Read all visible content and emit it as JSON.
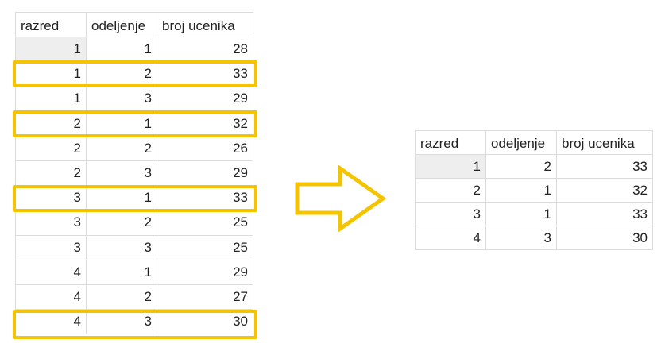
{
  "source_table": {
    "headers": [
      "razred",
      "odeljenje",
      "broj ucenika"
    ],
    "rows": [
      [
        "1",
        "1",
        "28"
      ],
      [
        "1",
        "2",
        "33"
      ],
      [
        "1",
        "3",
        "29"
      ],
      [
        "2",
        "1",
        "32"
      ],
      [
        "2",
        "2",
        "26"
      ],
      [
        "2",
        "3",
        "29"
      ],
      [
        "3",
        "1",
        "33"
      ],
      [
        "3",
        "2",
        "25"
      ],
      [
        "3",
        "3",
        "25"
      ],
      [
        "4",
        "1",
        "29"
      ],
      [
        "4",
        "2",
        "27"
      ],
      [
        "4",
        "3",
        "30"
      ]
    ],
    "highlighted_rows": [
      1,
      3,
      6,
      11
    ]
  },
  "result_table": {
    "headers": [
      "razred",
      "odeljenje",
      "broj ucenika"
    ],
    "rows": [
      [
        "1",
        "2",
        "33"
      ],
      [
        "2",
        "1",
        "32"
      ],
      [
        "3",
        "1",
        "33"
      ],
      [
        "4",
        "3",
        "30"
      ]
    ]
  },
  "colors": {
    "highlight": "#f5c400",
    "grid_line": "#dcdcdc",
    "selected_cell": "#eeeeee"
  }
}
